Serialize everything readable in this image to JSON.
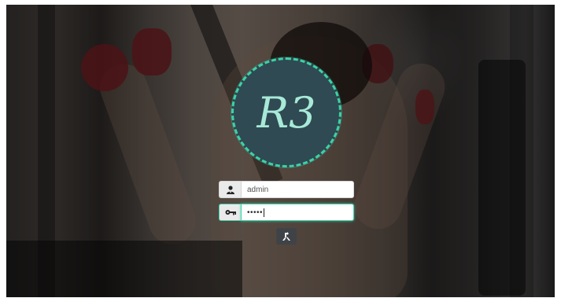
{
  "logo": {
    "text": "R3",
    "ring_color": "#3dd1a8",
    "fill_color": "#2f4a52",
    "text_color": "#a8e9d8"
  },
  "login": {
    "username_value": "admin",
    "password_value": "•••••",
    "user_icon": "user-icon",
    "key_icon": "key-icon",
    "submit_icon": "sign-in-icon",
    "focus_color": "#3dd1a8"
  }
}
